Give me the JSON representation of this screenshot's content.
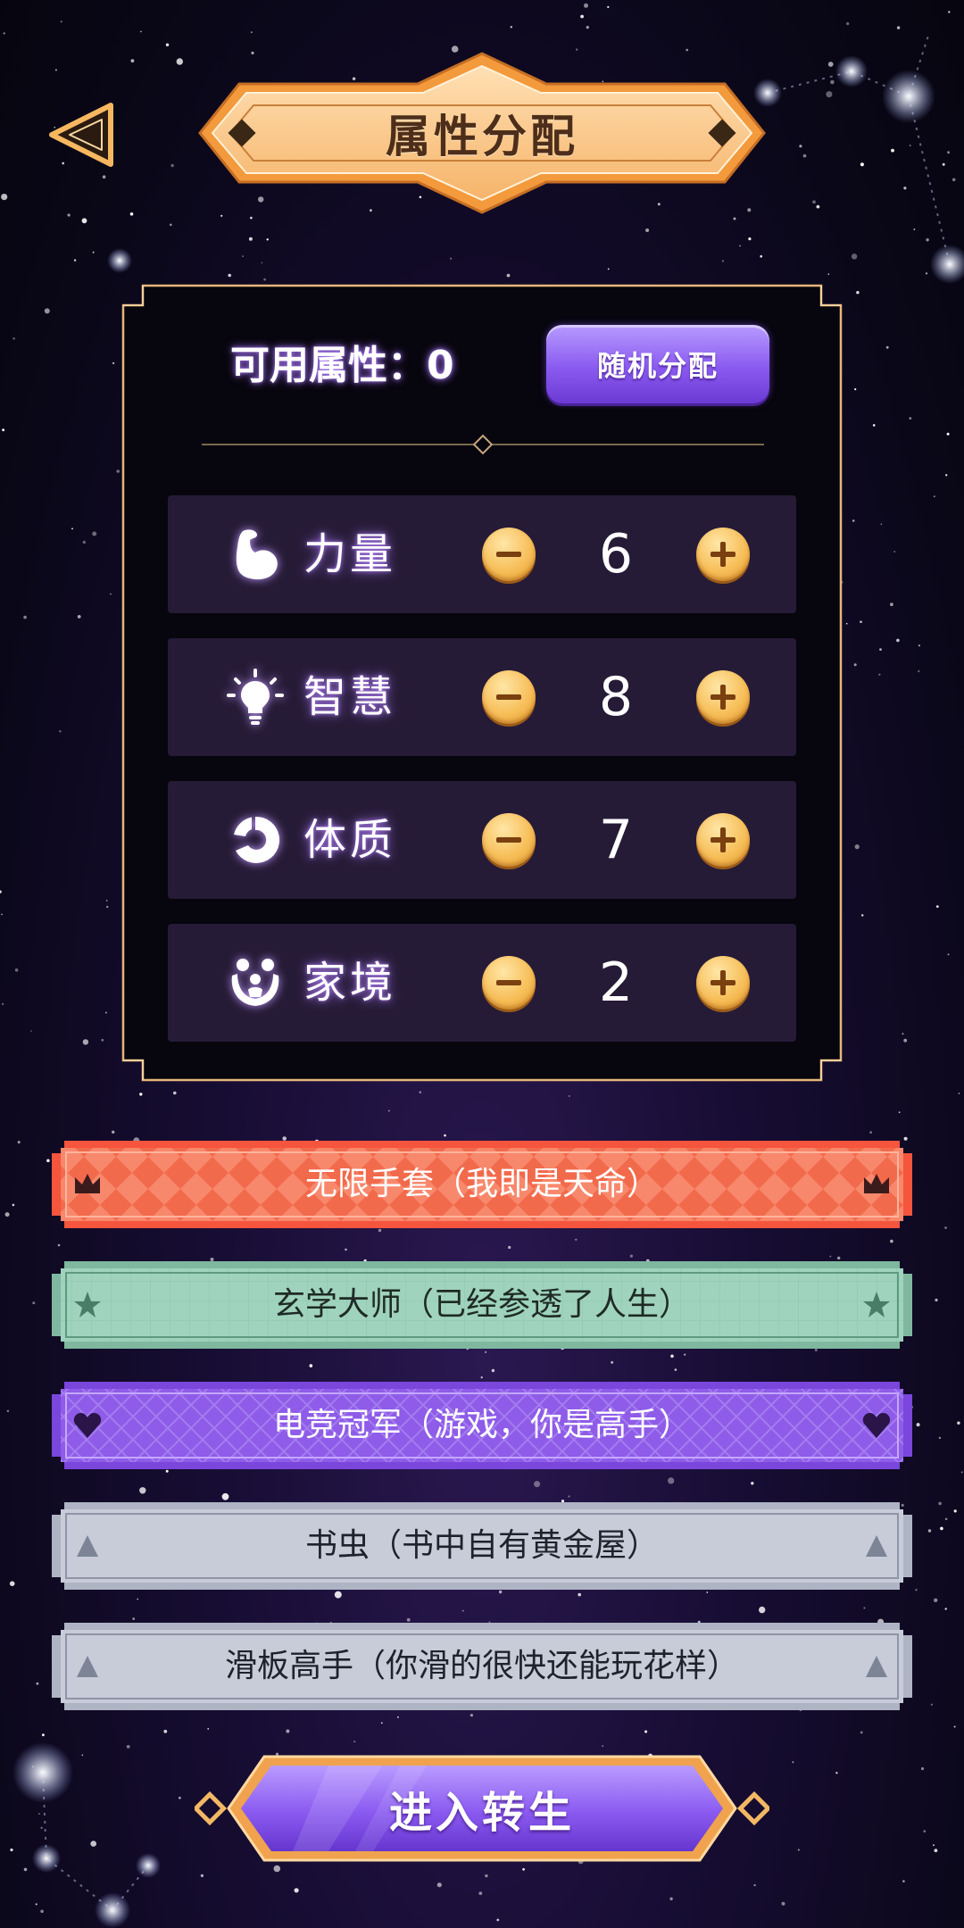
{
  "header": {
    "title": "属性分配",
    "back_icon": "back-triangle-icon"
  },
  "panel": {
    "available_label": "可用属性：",
    "available_points": "0",
    "random_button_label": "随机分配",
    "stats": [
      {
        "label": "力量",
        "value": "6",
        "icon": "muscle-arm-icon"
      },
      {
        "label": "智慧",
        "value": "8",
        "icon": "lightbulb-icon"
      },
      {
        "label": "体质",
        "value": "7",
        "icon": "body-ring-icon"
      },
      {
        "label": "家境",
        "value": "2",
        "icon": "family-icon"
      }
    ]
  },
  "talents": [
    {
      "label": "无限手套（我即是天命）",
      "icon": "crown-icon",
      "color": "#f26a4c"
    },
    {
      "label": "玄学大师（已经参透了人生）",
      "icon": "star-icon",
      "color": "#9fd3bd"
    },
    {
      "label": "电竞冠军（游戏，你是高手）",
      "icon": "heart-icon",
      "color": "#8e5ce8"
    },
    {
      "label": "书虫（书中自有黄金屋）",
      "icon": "triangle-icon",
      "color": "#c7ccd8"
    },
    {
      "label": "滑板高手（你滑的很快还能玩花样）",
      "icon": "triangle-icon",
      "color": "#c7ccd8"
    }
  ],
  "footer": {
    "enter_button_label": "进入转生"
  },
  "colors": {
    "accent_gold": "#f7c16b",
    "button_purple": "#8a5af0",
    "background": "#170d33"
  }
}
